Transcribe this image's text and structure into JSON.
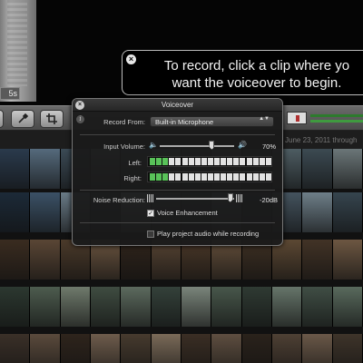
{
  "background": {
    "left_panel_time": "5s",
    "date_label": "June 23, 2011 through",
    "filmstrip_colors": [
      [
        "#2a3a4c",
        "#556a7c",
        "#3b4a55",
        "#6c7a7f",
        "#4a5a62",
        "#6d7e86",
        "#3d4d57",
        "#556068",
        "#2f3d47",
        "#4d5c62",
        "#3c4a52",
        "#6b7678"
      ],
      [
        "#1c2a38",
        "#3b5166",
        "#6a7b87",
        "#2d3d4a",
        "#8fa0aa",
        "#4c5e6b",
        "#32414c",
        "#5a6d78",
        "#26333e",
        "#44535e",
        "#6e7f89",
        "#36454f"
      ],
      [
        "#3a2c20",
        "#5a4635",
        "#4b3a2a",
        "#6a543f",
        "#2f241b",
        "#574433",
        "#4a3828",
        "#634e3a",
        "#3e3023",
        "#5c4833",
        "#423326",
        "#6d5742"
      ],
      [
        "#2c3830",
        "#4d5c4f",
        "#6f7a6c",
        "#3f4c41",
        "#5c6a5e",
        "#34413a",
        "#7a857b",
        "#48574b",
        "#2f3a33",
        "#66756a",
        "#404e45",
        "#596a5d"
      ],
      [
        "#3a3028",
        "#5a4a3c",
        "#2e241c",
        "#6e5c4c",
        "#463a2e",
        "#7a6a58",
        "#3a2e24",
        "#5e4e40",
        "#2a221b",
        "#4e4034",
        "#6a5848",
        "#3e342a"
      ]
    ]
  },
  "tooltip": {
    "line1": "To record, click a clip where yo",
    "line2": "want the voiceover to begin.",
    "close_glyph": "×"
  },
  "panel": {
    "title": "Voiceover",
    "close_glyph": "×",
    "info_glyph": "i",
    "record_from_label": "Record From:",
    "record_from_value": "Built-in Microphone",
    "select_arrows": "▲▼",
    "input_volume_label": "Input Volume:",
    "input_volume_value": "70%",
    "input_volume_level": 0.7,
    "vol_low_glyph": "🔈",
    "vol_high_glyph": "🔊",
    "left_label": "Left:",
    "right_label": "Right:",
    "meter_segments": 19,
    "meter_left_on": 3,
    "meter_right_on": 3,
    "noise_reduction_label": "Noise Reduction:",
    "noise_reduction_value": "-20dB",
    "noise_reduction_level": 0.95,
    "voice_enhancement_label": "Voice Enhancement",
    "voice_enhancement_checked": true,
    "play_audio_label": "Play project audio while recording",
    "play_audio_checked": false,
    "check_glyph": "✓"
  },
  "colors": {
    "meter_on": "#59c259",
    "meter_off": "#e2e2e2"
  }
}
